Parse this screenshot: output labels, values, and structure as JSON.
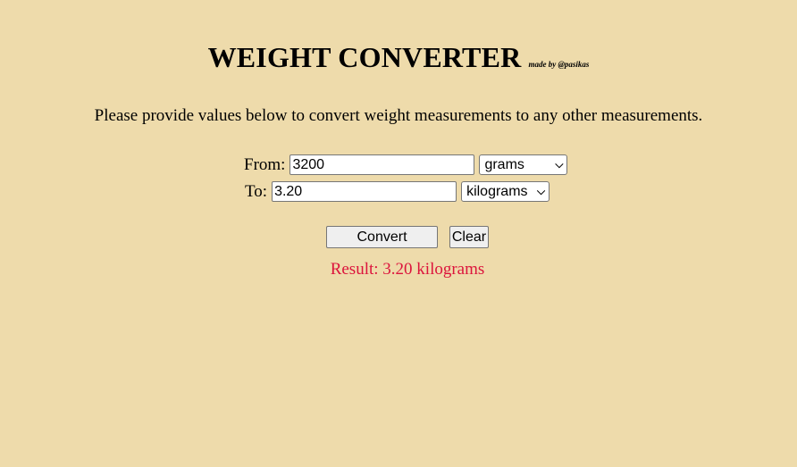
{
  "header": {
    "title": "WEIGHT CONVERTER",
    "credit": "made by @pasikas"
  },
  "intro": {
    "text": "Please provide values below to convert weight measurements to any other measurements."
  },
  "form": {
    "from": {
      "label": "From:",
      "value": "3200",
      "unit": "grams"
    },
    "to": {
      "label": "To:",
      "value": "3.20",
      "unit": "kilograms"
    }
  },
  "buttons": {
    "convert": "Convert",
    "clear": "Clear"
  },
  "result": {
    "text": "Result: 3.20 kilograms",
    "color": "#DC143C"
  },
  "colors": {
    "background": "#EEDBAB"
  }
}
